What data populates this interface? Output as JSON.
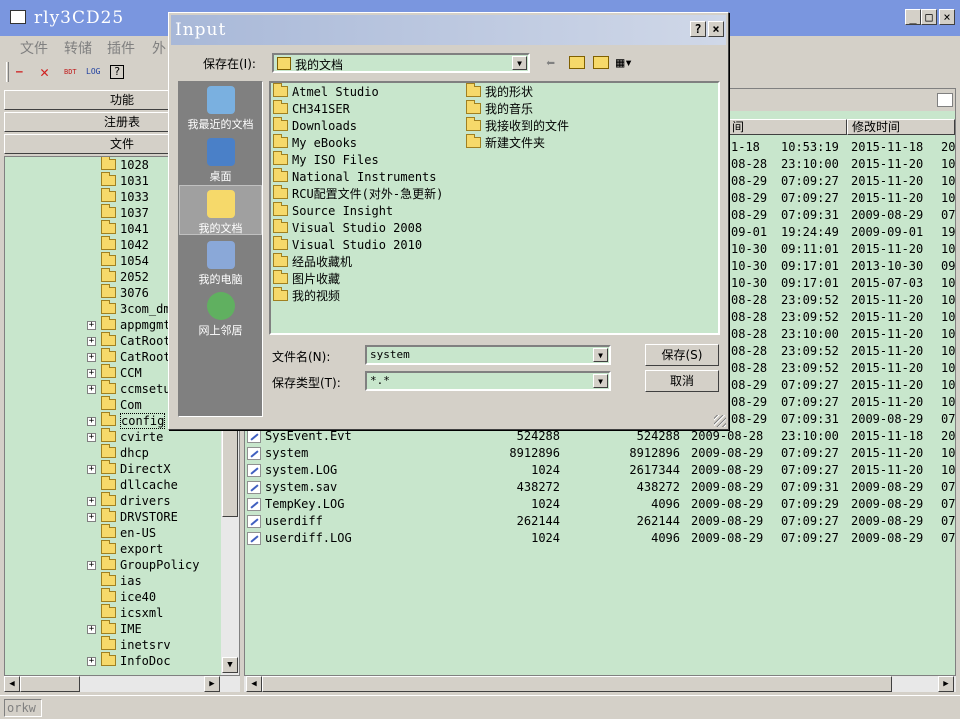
{
  "window": {
    "title": "rly3CD25",
    "min": "_",
    "max": "□",
    "close": "×"
  },
  "menu": [
    "文件",
    "转储",
    "插件",
    "外"
  ],
  "toolbar": {
    "minus": "—",
    "x": "✕",
    "bdt": "BDT",
    "log": "LOG",
    "help": "?"
  },
  "left_tabs": [
    "功能",
    "注册表",
    "文件"
  ],
  "tree_items": [
    {
      "label": "1028",
      "expand": false
    },
    {
      "label": "1031",
      "expand": false
    },
    {
      "label": "1033",
      "expand": false
    },
    {
      "label": "1037",
      "expand": false
    },
    {
      "label": "1041",
      "expand": false
    },
    {
      "label": "1042",
      "expand": false
    },
    {
      "label": "1054",
      "expand": false
    },
    {
      "label": "2052",
      "expand": false
    },
    {
      "label": "3076",
      "expand": false
    },
    {
      "label": "3com_dm",
      "expand": false
    },
    {
      "label": "appmgmt",
      "expand": true
    },
    {
      "label": "CatRoot",
      "expand": true
    },
    {
      "label": "CatRoot",
      "expand": true
    },
    {
      "label": "CCM",
      "expand": true
    },
    {
      "label": "ccmsetu",
      "expand": true
    },
    {
      "label": "Com",
      "expand": false
    },
    {
      "label": "config",
      "expand": true
    },
    {
      "label": "cvirte",
      "expand": true
    },
    {
      "label": "dhcp",
      "expand": false
    },
    {
      "label": "DirectX",
      "expand": true
    },
    {
      "label": "dllcache",
      "expand": false
    },
    {
      "label": "drivers",
      "expand": true
    },
    {
      "label": "DRVSTORE",
      "expand": true
    },
    {
      "label": "en-US",
      "expand": false
    },
    {
      "label": "export",
      "expand": false
    },
    {
      "label": "GroupPolicy",
      "expand": true
    },
    {
      "label": "ias",
      "expand": false
    },
    {
      "label": "ice40",
      "expand": false
    },
    {
      "label": "icsxml",
      "expand": false
    },
    {
      "label": "IME",
      "expand": true
    },
    {
      "label": "inetsrv",
      "expand": false
    },
    {
      "label": "InfoDoc",
      "expand": true
    }
  ],
  "file_columns": {
    "time": "间",
    "mtime": "修改时间"
  },
  "files_partial": [
    [
      "1-18",
      "10:53:19",
      "2015-11-18",
      "20"
    ],
    [
      "08-28",
      "23:10:00",
      "2015-11-20",
      "10"
    ],
    [
      "08-29",
      "07:09:27",
      "2015-11-20",
      "10"
    ],
    [
      "08-29",
      "07:09:27",
      "2015-11-20",
      "10"
    ],
    [
      "08-29",
      "07:09:31",
      "2009-08-29",
      "07"
    ],
    [
      "09-01",
      "19:24:49",
      "2009-09-01",
      "19"
    ],
    [
      "10-30",
      "09:11:01",
      "2015-11-20",
      "10"
    ],
    [
      "10-30",
      "09:17:01",
      "2013-10-30",
      "09"
    ],
    [
      "10-30",
      "09:17:01",
      "2015-07-03",
      "10"
    ],
    [
      "08-28",
      "23:09:52",
      "2015-11-20",
      "10"
    ],
    [
      "08-28",
      "23:09:52",
      "2015-11-20",
      "10"
    ],
    [
      "08-28",
      "23:10:00",
      "2015-11-20",
      "10"
    ],
    [
      "08-28",
      "23:09:52",
      "2015-11-20",
      "10"
    ],
    [
      "08-28",
      "23:09:52",
      "2015-11-20",
      "10"
    ],
    [
      "08-29",
      "07:09:27",
      "2015-11-20",
      "10"
    ],
    [
      "08-29",
      "07:09:27",
      "2015-11-20",
      "10"
    ],
    [
      "08-29",
      "07:09:31",
      "2009-08-29",
      "07"
    ]
  ],
  "files_full": [
    [
      "SysEvent.Evt",
      "524288",
      "524288",
      "2009-08-28",
      "23:10:00",
      "2015-11-18",
      "20"
    ],
    [
      "system",
      "8912896",
      "8912896",
      "2009-08-29",
      "07:09:27",
      "2015-11-20",
      "10"
    ],
    [
      "system.LOG",
      "1024",
      "2617344",
      "2009-08-29",
      "07:09:27",
      "2015-11-20",
      "10"
    ],
    [
      "system.sav",
      "438272",
      "438272",
      "2009-08-29",
      "07:09:31",
      "2009-08-29",
      "07"
    ],
    [
      "TempKey.LOG",
      "1024",
      "4096",
      "2009-08-29",
      "07:09:29",
      "2009-08-29",
      "07"
    ],
    [
      "userdiff",
      "262144",
      "262144",
      "2009-08-29",
      "07:09:27",
      "2009-08-29",
      "07"
    ],
    [
      "userdiff.LOG",
      "1024",
      "4096",
      "2009-08-29",
      "07:09:27",
      "2009-08-29",
      "07"
    ]
  ],
  "status": "orkw",
  "dialog": {
    "title": "Input",
    "help": "?",
    "close": "×",
    "save_in_label": "保存在(I):",
    "save_in_value": "我的文档",
    "places": [
      "我最近的文档",
      "桌面",
      "我的文档",
      "我的电脑",
      "网上邻居"
    ],
    "files_col1": [
      "Atmel Studio",
      "CH341SER",
      "Downloads",
      "My eBooks",
      "My ISO Files",
      "National Instruments",
      "RCU配置文件(对外-急更新)",
      "Source Insight",
      "Visual Studio 2008",
      "Visual Studio 2010",
      "经品收藏机",
      "图片收藏",
      "我的视频"
    ],
    "files_col2": [
      "我的形状",
      "我的音乐",
      "我接收到的文件",
      "新建文件夹"
    ],
    "filename_label": "文件名(N):",
    "filename_value": "system",
    "filetype_label": "保存类型(T):",
    "filetype_value": "*.*",
    "save_button": "保存(S)",
    "cancel_button": "取消"
  }
}
